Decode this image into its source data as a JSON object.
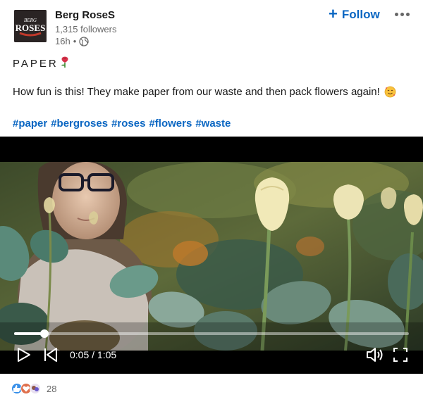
{
  "post": {
    "company_name": "Berg RoseS",
    "logo_text": "ROSES",
    "logo_top_text": "BERG",
    "followers": "1,315 followers",
    "time_ago": "16h",
    "meta_separator": "•",
    "follow_label": "Follow",
    "title": "PAPER",
    "text": "How fun is this! They make paper from our waste and then pack flowers again!",
    "hashtags": [
      "#paper",
      "#bergroses",
      "#roses",
      "#flowers",
      "#waste"
    ]
  },
  "video": {
    "time_display": "0:05 / 1:05",
    "progress_fraction": 0.077
  },
  "reactions": {
    "count": "28",
    "types": [
      "like",
      "love",
      "insightful"
    ]
  },
  "colors": {
    "accent": "#0a66c2",
    "like": "#378fe9",
    "love": "#df704d",
    "insightful": "#8f5849"
  },
  "icons": [
    "globe-icon",
    "rose-emoji-icon",
    "smiling-face-hearts-icon",
    "play-icon",
    "skip-back-icon",
    "volume-icon",
    "fullscreen-icon"
  ]
}
